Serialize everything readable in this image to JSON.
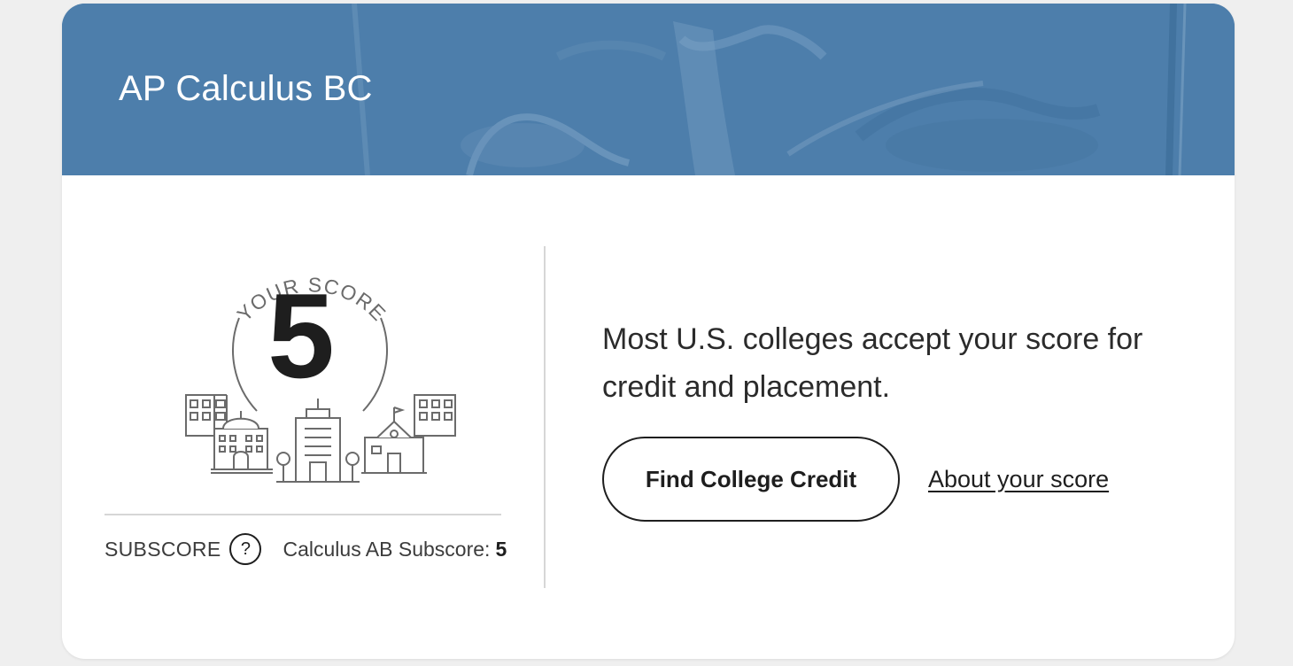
{
  "header": {
    "title": "AP Calculus BC",
    "background_color": "#4d7eab",
    "background_image": "glass-of-water-photo"
  },
  "score": {
    "arc_label": "YOUR SCORE",
    "value": "5",
    "illustration": "college-buildings-icon"
  },
  "subscore": {
    "label": "SUBSCORE",
    "help_icon": "?",
    "name": "Calculus AB Subscore:",
    "value": "5"
  },
  "message": {
    "text": "Most U.S. colleges accept your score for credit and placement."
  },
  "actions": {
    "find_label": "Find College Credit",
    "about_label": "About your score"
  }
}
